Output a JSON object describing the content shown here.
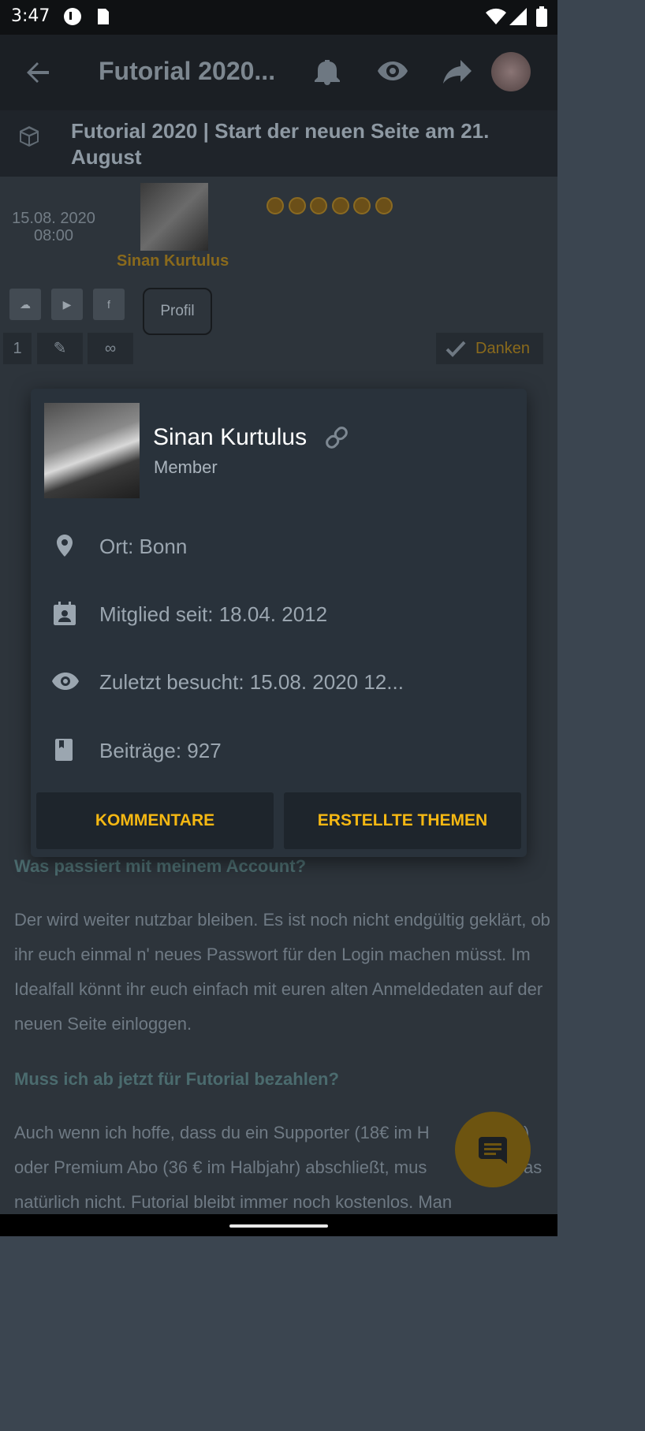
{
  "status_bar": {
    "time": "3:47"
  },
  "app_bar": {
    "title": "Futorial 2020..."
  },
  "thread": {
    "subtitle": "Futorial 2020 | Start der neuen Seite am 21. August"
  },
  "post": {
    "date": "15.08. 2020",
    "time": "08:00",
    "author": "Sinan Kurtulus",
    "profile_button": "Profil",
    "post_number": "1",
    "thanks_button": "Danken",
    "heading_account": "Was passiert mit meinem Account?",
    "paragraph_account": "Der wird weiter nutzbar bleiben. Es ist noch nicht endgültig geklärt, ob ihr euch einmal n' neues Passwort für den Login machen müsst. Im Idealfall könnt ihr euch einfach mit euren alten Anmeldedaten auf der neuen Seite einloggen.",
    "heading_pay": "Muss ich ab jetzt für Futorial bezahlen?",
    "paragraph_pay_1": "Auch wenn ich hoffe, dass du ein Supporter (18€ im H",
    "paragraph_pay_1b": ")",
    "paragraph_pay_2": "oder Premium Abo (36 € im Halbjahr) abschließt, mus",
    "paragraph_pay_2b": "as",
    "paragraph_pay_3": "natürlich nicht. Futorial bleibt immer noch kostenlos. Man"
  },
  "dialog": {
    "name": "Sinan Kurtulus",
    "role": "Member",
    "location": "Ort: Bonn",
    "member_since": "Mitglied seit: 18.04. 2012",
    "last_visit": "Zuletzt besucht: 15.08. 2020 12...",
    "posts": "Beiträge: 927",
    "btn_comments": "KOMMENTARE",
    "btn_topics": "ERSTELLTE THEMEN"
  },
  "colors": {
    "accent": "#f5b813",
    "dialog_bg": "#29323b",
    "button_bg": "#1e252c"
  },
  "icons": [
    "back-arrow-icon",
    "bell-icon",
    "eye-icon",
    "share-icon",
    "cube-icon",
    "check-icon",
    "link-icon",
    "location-pin-icon",
    "contact-card-icon",
    "eye-icon",
    "book-icon",
    "chat-icon"
  ]
}
